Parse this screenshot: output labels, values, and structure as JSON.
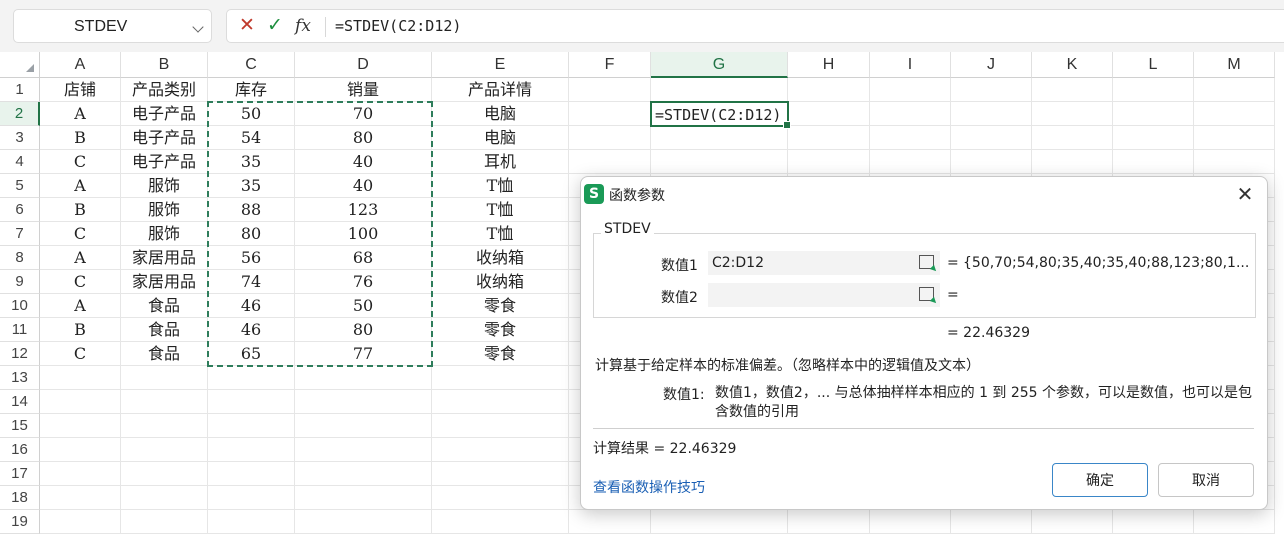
{
  "formula_bar": {
    "name_box": "STDEV",
    "cancel_glyph": "✕",
    "confirm_glyph": "✓",
    "fx_glyph": "fx",
    "formula": "=STDEV(C2:D12)"
  },
  "sheet": {
    "columns": [
      "A",
      "B",
      "C",
      "D",
      "E",
      "F",
      "G",
      "H",
      "I",
      "J",
      "K",
      "L",
      "M"
    ],
    "row_numbers": [
      "1",
      "2",
      "3",
      "4",
      "5",
      "6",
      "7",
      "8",
      "9",
      "10",
      "11",
      "12",
      "13",
      "14",
      "15",
      "16",
      "17",
      "18",
      "19"
    ],
    "headers": [
      "店铺",
      "产品类别",
      "库存",
      "销量",
      "产品详情"
    ],
    "rows": [
      [
        "A",
        "电子产品",
        "50",
        "70",
        "电脑"
      ],
      [
        "B",
        "电子产品",
        "54",
        "80",
        "电脑"
      ],
      [
        "C",
        "电子产品",
        "35",
        "40",
        "耳机"
      ],
      [
        "A",
        "服饰",
        "35",
        "40",
        "T恤"
      ],
      [
        "B",
        "服饰",
        "88",
        "123",
        "T恤"
      ],
      [
        "C",
        "服饰",
        "80",
        "100",
        "T恤"
      ],
      [
        "A",
        "家居用品",
        "56",
        "68",
        "收纳箱"
      ],
      [
        "C",
        "家居用品",
        "74",
        "76",
        "收纳箱"
      ],
      [
        "A",
        "食品",
        "46",
        "50",
        "零食"
      ],
      [
        "B",
        "食品",
        "46",
        "80",
        "零食"
      ],
      [
        "C",
        "食品",
        "65",
        "77",
        "零食"
      ]
    ],
    "active_cell_text": "=STDEV(C2:D12)"
  },
  "dialog": {
    "icon_letter": "S",
    "title": "函数参数",
    "close_glyph": "✕",
    "function_name": "STDEV",
    "args": [
      {
        "label": "数值1",
        "value": "C2:D12",
        "result": "{50,70;54,80;35,40;35,40;88,123;80,1..."
      },
      {
        "label": "数值2",
        "value": "",
        "result": ""
      }
    ],
    "eq": "=",
    "total": "= 22.46329",
    "description": "计算基于给定样本的标准偏差。（忽略样本中的逻辑值及文本）",
    "param_name": "数值1:",
    "param_desc": "数值1，数值2，... 与总体抽样样本相应的 1 到 255 个参数，可以是数值，也可以是包含数值的引用",
    "calc_result": "计算结果 = 22.46329",
    "tips_link": "查看函数操作技巧",
    "ok": "确定",
    "cancel": "取消"
  },
  "colors": {
    "accent_green": "#217346",
    "marquee": "#2e7d5b",
    "link_blue": "#1a5fb4"
  }
}
